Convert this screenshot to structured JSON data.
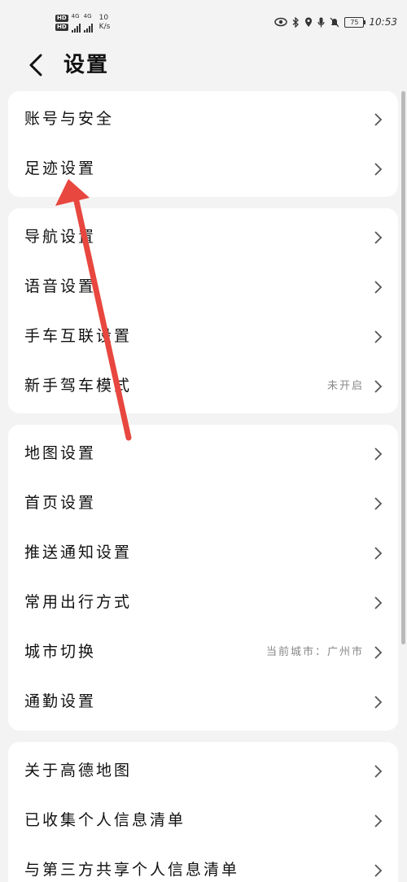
{
  "status_bar": {
    "hd1": "HD",
    "hd2": "HD",
    "net1": "4G",
    "net2": "4G",
    "speed_value": "10",
    "speed_unit": "K/s",
    "battery": "75",
    "time": "10:53"
  },
  "header": {
    "title": "设置"
  },
  "groups": [
    {
      "items": [
        {
          "label": "账号与安全",
          "value": ""
        },
        {
          "label": "足迹设置",
          "value": ""
        }
      ]
    },
    {
      "items": [
        {
          "label": "导航设置",
          "value": ""
        },
        {
          "label": "语音设置",
          "value": ""
        },
        {
          "label": "手车互联设置",
          "value": ""
        },
        {
          "label": "新手驾车模式",
          "value": "未开启"
        }
      ]
    },
    {
      "items": [
        {
          "label": "地图设置",
          "value": ""
        },
        {
          "label": "首页设置",
          "value": ""
        },
        {
          "label": "推送通知设置",
          "value": ""
        },
        {
          "label": "常用出行方式",
          "value": ""
        },
        {
          "label": "城市切换",
          "value": "当前城市：广州市"
        },
        {
          "label": "通勤设置",
          "value": ""
        }
      ]
    },
    {
      "items": [
        {
          "label": "关于高德地图",
          "value": ""
        },
        {
          "label": "已收集个人信息清单",
          "value": ""
        },
        {
          "label": "与第三方共享个人信息清单",
          "value": ""
        }
      ]
    }
  ],
  "colors": {
    "background": "#f3f3f3",
    "card": "#ffffff",
    "annotation_arrow": "#e8473f"
  }
}
